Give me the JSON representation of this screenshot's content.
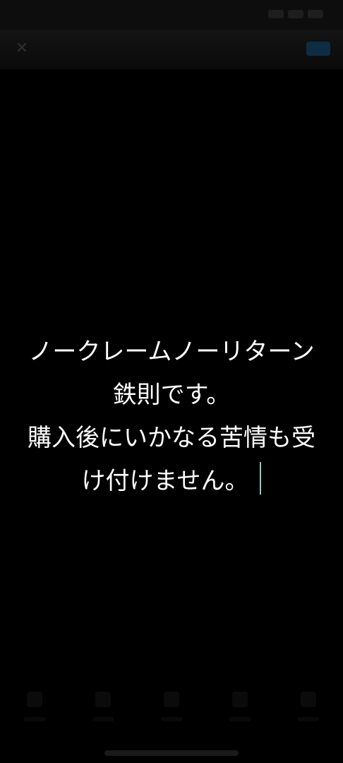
{
  "caption": {
    "lines": [
      "ノークレームノーリターン",
      "鉄則です。",
      "購入後にいかなる苦情も受",
      "け付けません。"
    ]
  },
  "colors": {
    "background": "#000000",
    "text": "#ffffff",
    "caret": "#8fc9c2"
  },
  "toolbar": {
    "tool_icons": [
      "pen-icon",
      "text-style-icon",
      "align-icon",
      "color-icon",
      "font-icon"
    ]
  }
}
